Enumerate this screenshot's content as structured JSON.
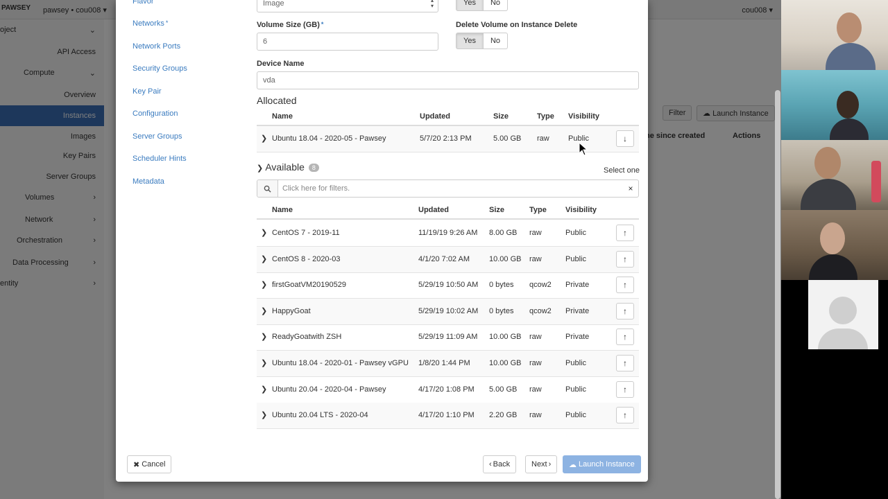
{
  "background": {
    "brand": "PAWSEY",
    "project": "pawsey • cou008 ▾",
    "user": "cou008 ▾",
    "nav": [
      {
        "label": "oject",
        "level": 1,
        "chevron": "⌄"
      },
      {
        "label": "API Access",
        "level": 2
      },
      {
        "label": "Compute",
        "level": 1,
        "chevron": "⌄"
      },
      {
        "label": "Overview",
        "level": 2
      },
      {
        "label": "Instances",
        "level": 2,
        "active": true
      },
      {
        "label": "Images",
        "level": 2
      },
      {
        "label": "Key Pairs",
        "level": 2
      },
      {
        "label": "Server Groups",
        "level": 2
      },
      {
        "label": "Volumes",
        "level": 1,
        "chevron": "›"
      },
      {
        "label": "Network",
        "level": 1,
        "chevron": "›"
      },
      {
        "label": "Orchestration",
        "level": 1,
        "chevron": "›"
      },
      {
        "label": "Data Processing",
        "level": 1,
        "chevron": "›"
      },
      {
        "label": "entity",
        "level": 1,
        "chevron": "›"
      }
    ],
    "toolbar": {
      "filter": "Filter",
      "launch": "Launch Instance"
    },
    "table_headers": {
      "time": "ne since created",
      "actions": "Actions"
    }
  },
  "wizard_nav": {
    "items": [
      {
        "label": "Flavor",
        "required": false
      },
      {
        "label": "Networks",
        "required": true
      },
      {
        "label": "Network Ports",
        "required": false
      },
      {
        "label": "Security Groups",
        "required": false
      },
      {
        "label": "Key Pair",
        "required": false
      },
      {
        "label": "Configuration",
        "required": false
      },
      {
        "label": "Server Groups",
        "required": false
      },
      {
        "label": "Scheduler Hints",
        "required": false
      },
      {
        "label": "Metadata",
        "required": false
      }
    ],
    "required_mark": "*"
  },
  "form": {
    "boot_source_value": "Image",
    "create_volume": {
      "yes": "Yes",
      "no": "No",
      "selected": "Yes"
    },
    "volume_size_label": "Volume Size (GB)",
    "volume_size_value": "6",
    "delete_volume_label": "Delete Volume on Instance Delete",
    "delete_volume": {
      "yes": "Yes",
      "no": "No",
      "selected": "Yes"
    },
    "device_name_label": "Device Name",
    "device_name_value": "vda"
  },
  "allocated": {
    "title": "Allocated",
    "headers": {
      "name": "Name",
      "updated": "Updated",
      "size": "Size",
      "type": "Type",
      "visibility": "Visibility"
    },
    "rows": [
      {
        "name": "Ubuntu 18.04 - 2020-05 - Pawsey",
        "updated": "5/7/20 2:13 PM",
        "size": "5.00 GB",
        "type": "raw",
        "visibility": "Public"
      }
    ]
  },
  "available": {
    "title": "Available",
    "count": "8",
    "select_hint": "Select one",
    "filter_placeholder": "Click here for filters.",
    "clear": "×",
    "headers": {
      "name": "Name",
      "updated": "Updated",
      "size": "Size",
      "type": "Type",
      "visibility": "Visibility"
    },
    "rows": [
      {
        "name": "CentOS 7 - 2019-11",
        "updated": "11/19/19 9:26 AM",
        "size": "8.00 GB",
        "type": "raw",
        "visibility": "Public"
      },
      {
        "name": "CentOS 8 - 2020-03",
        "updated": "4/1/20 7:02 AM",
        "size": "10.00 GB",
        "type": "raw",
        "visibility": "Public"
      },
      {
        "name": "firstGoatVM20190529",
        "updated": "5/29/19 10:50 AM",
        "size": "0 bytes",
        "type": "qcow2",
        "visibility": "Private"
      },
      {
        "name": "HappyGoat",
        "updated": "5/29/19 10:02 AM",
        "size": "0 bytes",
        "type": "qcow2",
        "visibility": "Private"
      },
      {
        "name": "ReadyGoatwith ZSH",
        "updated": "5/29/19 11:09 AM",
        "size": "10.00 GB",
        "type": "raw",
        "visibility": "Private"
      },
      {
        "name": "Ubuntu 18.04 - 2020-01 - Pawsey vGPU",
        "updated": "1/8/20 1:44 PM",
        "size": "10.00 GB",
        "type": "raw",
        "visibility": "Public"
      },
      {
        "name": "Ubuntu 20.04 - 2020-04 - Pawsey",
        "updated": "4/17/20 1:08 PM",
        "size": "5.00 GB",
        "type": "raw",
        "visibility": "Public"
      },
      {
        "name": "Ubuntu 20.04 LTS - 2020-04",
        "updated": "4/17/20 1:10 PM",
        "size": "2.20 GB",
        "type": "raw",
        "visibility": "Public"
      }
    ]
  },
  "footer": {
    "cancel": "Cancel",
    "back": "Back",
    "next": "Next",
    "launch": "Launch Instance"
  },
  "colors": {
    "link": "#3a7bbf",
    "active_nav": "#3b6fb6",
    "primary_disabled": "#8db3e2"
  },
  "icons": {
    "expand": "chevron-right-icon",
    "collapse": "chevron-down-icon",
    "allocate": "arrow-up-icon",
    "deallocate": "arrow-down-icon",
    "search": "search-icon",
    "cancel": "close-icon",
    "back": "chevron-left-icon",
    "next": "chevron-right-icon",
    "launch": "cloud-upload-icon"
  }
}
